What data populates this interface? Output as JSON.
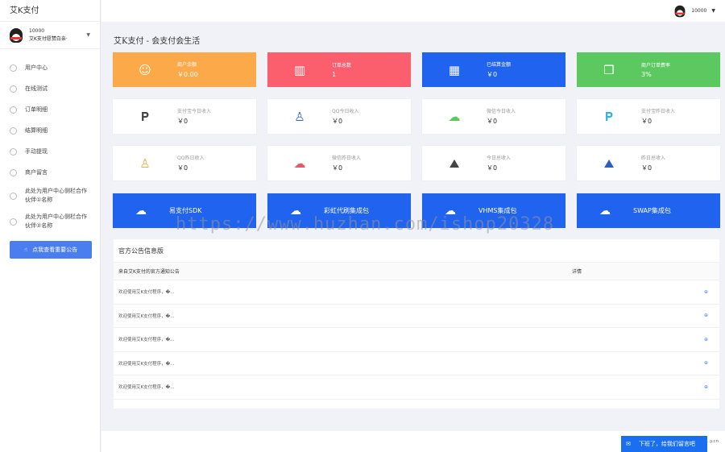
{
  "sidebar": {
    "brand": "艾K支付",
    "user_id": "10000",
    "user_name": "艾K支付愿赞白亲·",
    "items": [
      {
        "label": "用户中心"
      },
      {
        "label": "在线测试"
      },
      {
        "label": "订单明细"
      },
      {
        "label": "结算明细"
      },
      {
        "label": "手动提现"
      },
      {
        "label": "商户留言"
      },
      {
        "label": "此处为用户中心侧栏合作伙伴①名称"
      },
      {
        "label": "此处为用户中心侧栏合作伙伴②名称"
      }
    ],
    "notice_button": "点我查看重要公告"
  },
  "topbar": {
    "user_id": "10000"
  },
  "page_title": "艾K支付 - 会支付会生活",
  "stats": [
    {
      "label": "商户余额",
      "value": "￥0.00",
      "icon": "smile-icon",
      "color": "#fca94a"
    },
    {
      "label": "订单总数",
      "value": "1",
      "icon": "bar-chart-icon",
      "color": "#fb5f6e"
    },
    {
      "label": "已结算金额",
      "value": "￥0",
      "icon": "calculator-icon",
      "color": "#1f63ee"
    },
    {
      "label": "商户订单费率",
      "value": "3%",
      "icon": "css3-icon",
      "color": "#5cc960"
    },
    {
      "label": "支付宝今日收入",
      "value": "￥0",
      "icon": "paypal-icon",
      "color": "#444444"
    },
    {
      "label": "QQ今日收入",
      "value": "￥0",
      "icon": "qq-icon",
      "color": "#3462c9"
    },
    {
      "label": "微信今日收入",
      "value": "￥0",
      "icon": "wechat-icon",
      "color": "#5cc960"
    },
    {
      "label": "支付宝昨日收入",
      "value": "￥0",
      "icon": "paypal-icon",
      "color": "#2ab6d8"
    },
    {
      "label": "QQ昨日收入",
      "value": "￥0",
      "icon": "qq-icon",
      "color": "#f0a94a"
    },
    {
      "label": "微信昨日收入",
      "value": "￥0",
      "icon": "wechat-icon",
      "color": "#e45a6a"
    },
    {
      "label": "今日总收入",
      "value": "￥0",
      "icon": "area-chart-icon",
      "color": "#444444"
    },
    {
      "label": "昨日总收入",
      "value": "￥0",
      "icon": "area-chart-icon",
      "color": "#2c5fb8"
    }
  ],
  "sdks": [
    {
      "label": "易支付SDK"
    },
    {
      "label": "彩虹代刷集成包"
    },
    {
      "label": "VHMS集成包"
    },
    {
      "label": "SWAP集成包"
    }
  ],
  "panel": {
    "title": "官方公告信息版",
    "col1": "来自艾K支付的官方通知公告",
    "col2": "详情",
    "rows": [
      {
        "text": "欢迎使用艾K支付程序，�...",
        "op": "⊕"
      },
      {
        "text": "欢迎使用艾K支付程序，�...",
        "op": "⊕"
      },
      {
        "text": "欢迎使用艾K支付程序，�...",
        "op": "⊕"
      },
      {
        "text": "欢迎使用艾K支付程序，�...",
        "op": "⊕"
      },
      {
        "text": "欢迎使用艾K支付程序，�...",
        "op": "⊕"
      }
    ]
  },
  "footer": {
    "copyright": "Copyright © ......................y.cn"
  },
  "chat": {
    "label": "下班了，给我们留言吧"
  },
  "watermark": "https://www.huzhan.com/ishop20328"
}
